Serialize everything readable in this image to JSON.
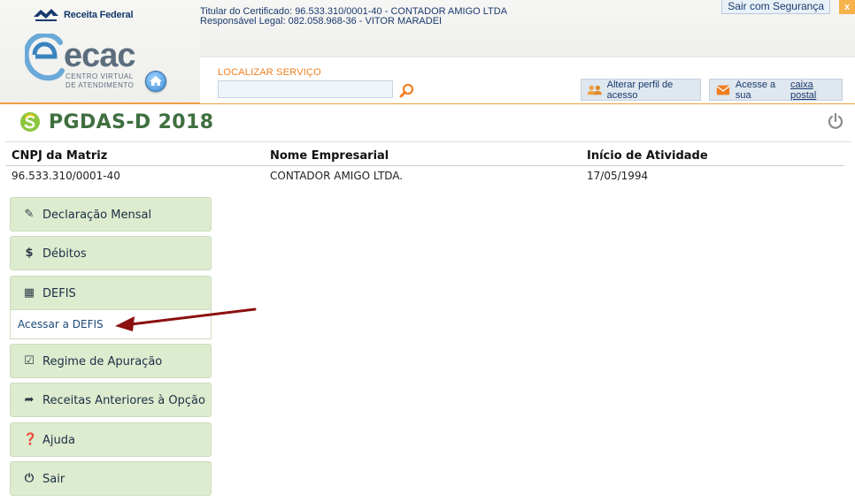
{
  "header": {
    "rf_logo_text": "Receita Federal",
    "ecac_word": "ecac",
    "ecac_sub1": "CENTRO VIRTUAL",
    "ecac_sub2": "DE ATENDIMENTO",
    "certificate_line": "Titular do Certificado: 96.533.310/0001-40 - CONTADOR AMIGO LTDA",
    "responsible_line": "Responsável Legal: 082.058.968-36 - VITOR MARADEI",
    "logout_label": "Sair com Segurança",
    "logout_close": "x",
    "search_label": "LOCALIZAR SERVIÇO",
    "search_value": "",
    "alter_profile_label": "Alterar perfil de acesso",
    "mailbox_prefix": "Acesse a sua",
    "mailbox_link": "caixa postal"
  },
  "page": {
    "title": "PGDAS-D 2018"
  },
  "info_table": {
    "headers": [
      "CNPJ da Matriz",
      "Nome Empresarial",
      "Início de Atividade"
    ],
    "row": [
      "96.533.310/0001-40",
      "CONTADOR AMIGO LTDA.",
      "17/05/1994"
    ]
  },
  "menu": {
    "items": [
      {
        "label": "Declaração Mensal",
        "icon": "pencil-icon",
        "glyph": "✎"
      },
      {
        "label": "Débitos",
        "icon": "dollar-icon",
        "glyph": "$"
      },
      {
        "label": "DEFIS",
        "icon": "calendar-icon",
        "glyph": "▦"
      },
      {
        "label": "Regime de Apuração",
        "icon": "checkbox-icon",
        "glyph": "☑"
      },
      {
        "label": "Receitas Anteriores à Opção",
        "icon": "share-arrow-icon",
        "glyph": "➦"
      },
      {
        "label": "Ajuda",
        "icon": "question-icon",
        "glyph": "❓"
      },
      {
        "label": "Sair",
        "icon": "power-icon",
        "glyph": "⏻"
      }
    ],
    "submenu_label": "Acessar a DEFIS"
  },
  "colors": {
    "menu_bg": "#ddeccf",
    "title_green": "#3f6f3f",
    "header_accent": "#f0a040",
    "arrow_red": "#8b1010",
    "link_blue": "#1b4a78"
  }
}
